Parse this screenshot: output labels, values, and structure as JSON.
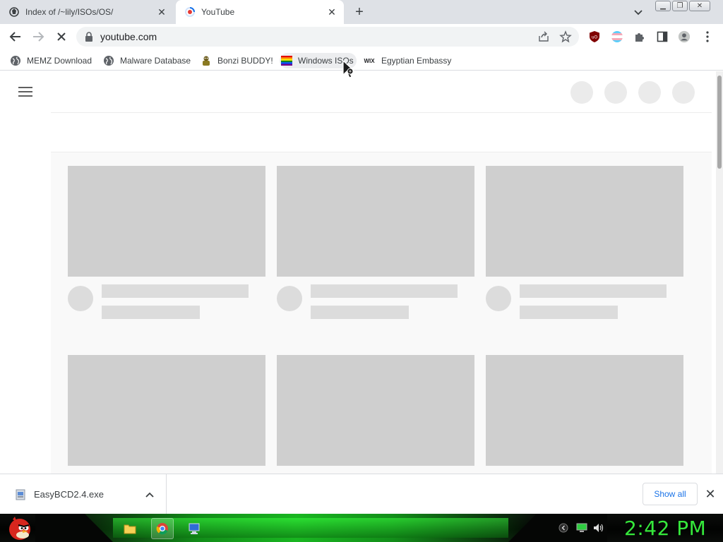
{
  "browser": {
    "tabs": [
      {
        "title": "Index of /~lily/ISOs/OS/",
        "close": "✕"
      },
      {
        "title": "YouTube",
        "close": "✕"
      }
    ],
    "new_tab": "+",
    "url": "youtube.com",
    "bookmarks": [
      {
        "label": "MEMZ Download",
        "icon": "globe-icon"
      },
      {
        "label": "Malware Database",
        "icon": "globe-icon"
      },
      {
        "label": "Bonzi BUDDY!",
        "icon": "bonzi-icon"
      },
      {
        "label": "Windows ISOs",
        "icon": "rainbow-flag-icon"
      },
      {
        "label": "Egyptian Embassy",
        "icon": "wix-icon"
      }
    ],
    "bookmark_wix_text": "WIX"
  },
  "downloads": {
    "file_name": "EasyBCD2.4.exe",
    "show_all_label": "Show all",
    "close": "✕"
  },
  "taskbar": {
    "clock": "2:42 PM",
    "accent": "#35e83b"
  },
  "window_controls": {
    "minimize": "▁",
    "maximize": "❐",
    "close": "✕"
  },
  "colors": {
    "page_bg": "#ffffff",
    "skeleton": "#cfcfcf",
    "link_blue": "#1a73e8"
  }
}
